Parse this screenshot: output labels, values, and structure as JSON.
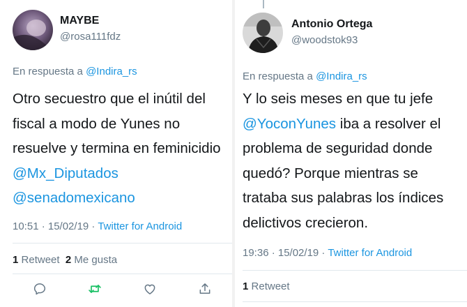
{
  "tweets": [
    {
      "display_name": "MAYBE",
      "handle": "@rosa111fdz",
      "reply_prefix": "En respuesta a",
      "reply_to": "@Indira_rs",
      "body_lines": [
        "Otro secuestro que el inútil del",
        "fiscal a modo de Yunes no",
        "resuelve y termina en feminicidio"
      ],
      "mention_lines": [
        "@Mx_Diputados",
        "@senadomexicano"
      ],
      "timestamp": "10:51 · 15/02/19 ·",
      "source": "Twitter for Android",
      "retweet_count": "1",
      "retweet_label": "Retweet",
      "like_count": "2",
      "like_label": "Me gusta"
    },
    {
      "display_name": "Antonio Ortega",
      "handle": "@woodstok93",
      "reply_prefix": "En respuesta a",
      "reply_to": "@Indira_rs",
      "body_line1": "Y lo seis meses en que tu jefe",
      "body_mention": "@YoconYunes",
      "body_line2_rest": " iba a resolver el",
      "body_lines_after": [
        "problema de seguridad donde",
        "quedó? Porque mientras se",
        "trataba sus palabras los índices",
        "delictivos crecieron."
      ],
      "timestamp": "19:36 · 15/02/19 ·",
      "source": "Twitter for Android",
      "retweet_count": "1",
      "retweet_label": "Retweet"
    }
  ],
  "colors": {
    "accent": "#1b95e0",
    "muted": "#657786",
    "retweet_green": "#17bf63",
    "divider": "#e1e8ed"
  },
  "icons": [
    "reply-icon",
    "retweet-icon",
    "like-icon",
    "share-icon"
  ]
}
